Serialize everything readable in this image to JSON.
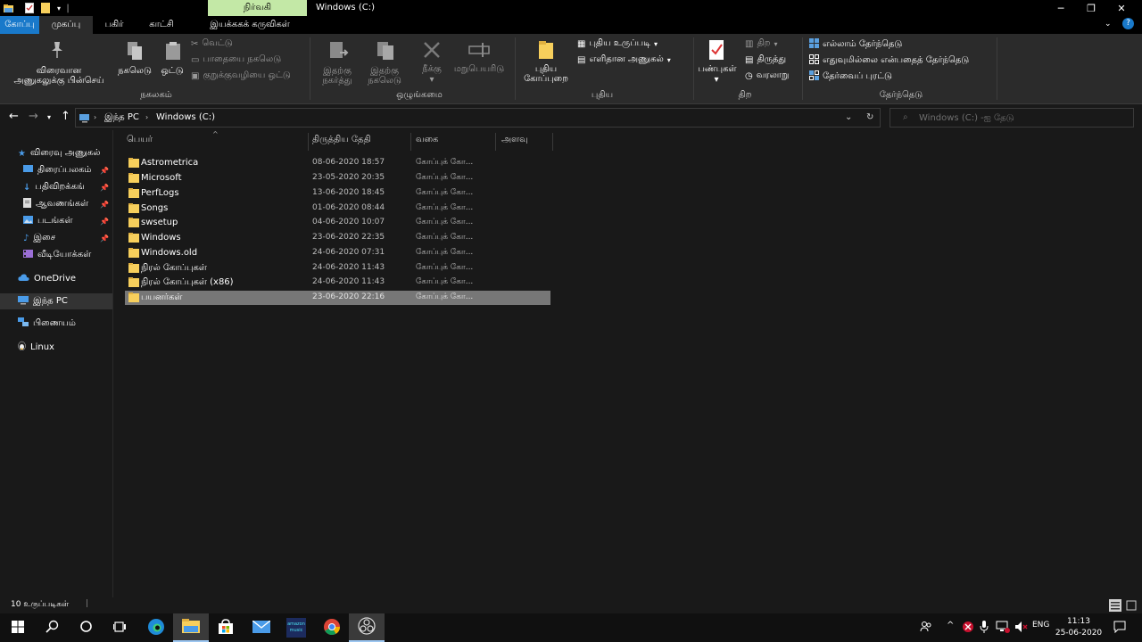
{
  "window": {
    "title": "Windows (C:)",
    "context_tab": "நிர்வகி"
  },
  "ribbon_tabs": [
    {
      "label": "கோப்பு"
    },
    {
      "label": "முகப்பு"
    },
    {
      "label": "பகிர்"
    },
    {
      "label": "காட்சி"
    },
    {
      "label": "இயக்ககக் கருவிகள்"
    }
  ],
  "ribbon": {
    "clipboard": {
      "pin_label_1": "விரைவான",
      "pin_label_2": "அணுகலுக்கு பின்செய்",
      "copy": "நகலெடு",
      "paste": "ஒட்டு",
      "cut": "வெட்டு",
      "copy_path": "பாதையை நகலெடு",
      "paste_shortcut": "குறுக்குவழியை ஒட்டு",
      "group": "நகலகம்"
    },
    "organize": {
      "move_to_1": "இதற்கு",
      "move_to_2": "நகர்த்து",
      "copy_to_1": "இதற்கு",
      "copy_to_2": "நகலெடு",
      "delete": "நீக்கு",
      "rename": "மறுபெயரிடு",
      "group": "ஒழுங்கமை"
    },
    "new": {
      "new_folder_1": "புதிய",
      "new_folder_2": "கோப்புறை",
      "new_item": "புதிய உருப்படி",
      "easy_access": "எளிதான அணுகல்",
      "group": "புதிய"
    },
    "open": {
      "properties": "பண்புகள்",
      "open": "திற",
      "edit": "திருத்து",
      "history": "வரலாறு",
      "group": "திற"
    },
    "select": {
      "select_all": "எல்லாம் தேர்ந்தெடு",
      "select_none": "எதுவுமில்லை என்பதைத் தேர்ந்தெடு",
      "invert": "தேர்வைப் புரட்டு",
      "group": "தேர்ந்தெடு"
    }
  },
  "address": {
    "crumbs": [
      "இந்த PC",
      "Windows (C:)"
    ],
    "search_placeholder": "Windows (C:) -ஐ தேடு"
  },
  "nav": {
    "quick_access": "விரைவு அணுகல்",
    "items": [
      {
        "label": "திரைப்பலகம்",
        "icon": "desktop-icon"
      },
      {
        "label": "பதிவிறக்கங்",
        "icon": "download-icon"
      },
      {
        "label": "ஆவணங்கள்",
        "icon": "document-icon"
      },
      {
        "label": "படங்கள்",
        "icon": "pictures-icon"
      },
      {
        "label": "இசை",
        "icon": "music-icon"
      },
      {
        "label": "வீடியோக்கள்",
        "icon": "video-icon"
      }
    ],
    "onedrive": "OneDrive",
    "this_pc": "இந்த PC",
    "network": "பிணையம்",
    "linux": "Linux"
  },
  "columns": {
    "name": "பெயர்",
    "modified": "திருத்திய தேதி",
    "type": "வகை",
    "size": "அளவு"
  },
  "files": [
    {
      "name": "Astrometrica",
      "date": "08-06-2020 18:57",
      "type": "கோப்புக் கோ..."
    },
    {
      "name": "Microsoft",
      "date": "23-05-2020 20:35",
      "type": "கோப்புக் கோ..."
    },
    {
      "name": "PerfLogs",
      "date": "13-06-2020 18:45",
      "type": "கோப்புக் கோ..."
    },
    {
      "name": "Songs",
      "date": "01-06-2020 08:44",
      "type": "கோப்புக் கோ..."
    },
    {
      "name": "swsetup",
      "date": "04-06-2020 10:07",
      "type": "கோப்புக் கோ..."
    },
    {
      "name": "Windows",
      "date": "23-06-2020 22:35",
      "type": "கோப்புக் கோ..."
    },
    {
      "name": "Windows.old",
      "date": "24-06-2020 07:31",
      "type": "கோப்புக் கோ..."
    },
    {
      "name": "நிரல் கோப்புகள்",
      "date": "24-06-2020 11:43",
      "type": "கோப்புக் கோ..."
    },
    {
      "name": "நிரல் கோப்புகள் (x86)",
      "date": "24-06-2020 11:43",
      "type": "கோப்புக் கோ..."
    },
    {
      "name": "பயனர்கள்",
      "date": "23-06-2020 22:16",
      "type": "கோப்புக் கோ..."
    }
  ],
  "status": {
    "count": "10 உருப்படிகள்"
  },
  "taskbar": {
    "apps": [
      "windows-start-icon",
      "search-icon",
      "cortana-icon",
      "task-view-icon",
      "edge-icon",
      "file-explorer-icon",
      "store-icon",
      "mail-icon",
      "amazon-music-icon",
      "chrome-icon",
      "obs-icon"
    ],
    "amazon_music_label": "amazon music",
    "lang": "ENG",
    "time": "11:13",
    "date": "25-06-2020"
  },
  "colors": {
    "file_tab": "#1979ca",
    "context_tab": "#c3e8a6",
    "folder": "#f7cf5c",
    "selection": "#777777"
  }
}
